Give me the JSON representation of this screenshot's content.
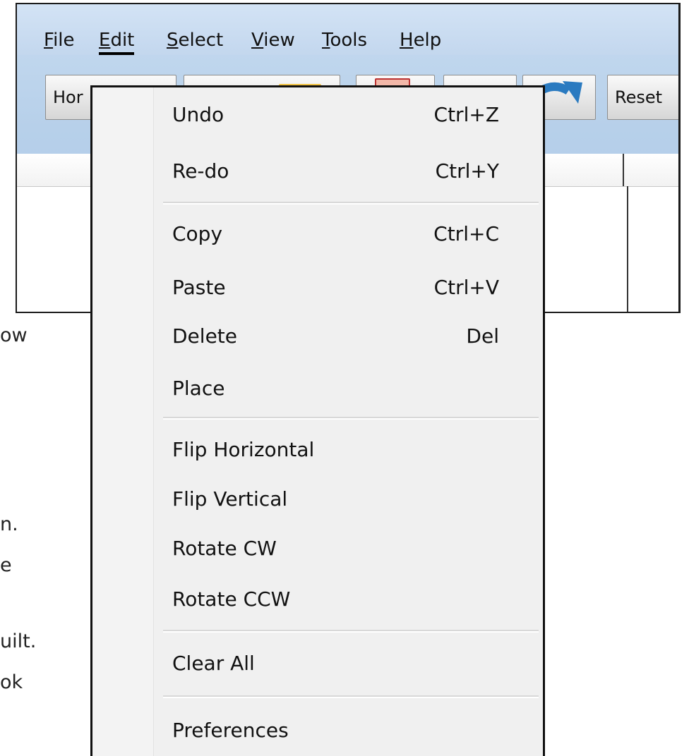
{
  "menubar": {
    "items": [
      {
        "mnemonic": "F",
        "rest": "ile"
      },
      {
        "mnemonic": "E",
        "rest": "dit"
      },
      {
        "mnemonic": "S",
        "rest": "elect"
      },
      {
        "mnemonic": "V",
        "rest": "iew"
      },
      {
        "mnemonic": "T",
        "rest": "ools"
      },
      {
        "mnemonic": "H",
        "rest": "elp"
      }
    ]
  },
  "toolbar": {
    "home_label": "Hor",
    "reset_label": "Reset"
  },
  "background_text": [
    "ow",
    "n.",
    "e",
    "uilt.",
    "ok"
  ],
  "edit_menu": {
    "items": [
      {
        "label": "Undo",
        "shortcut": "Ctrl+Z"
      },
      {
        "label": "Re-do",
        "shortcut": "Ctrl+Y"
      },
      {
        "label": "Copy",
        "shortcut": "Ctrl+C"
      },
      {
        "label": "Paste",
        "shortcut": "Ctrl+V"
      },
      {
        "label": "Delete",
        "shortcut": "Del"
      },
      {
        "label": "Place",
        "shortcut": ""
      },
      {
        "label": "Flip Horizontal",
        "shortcut": ""
      },
      {
        "label": "Flip Vertical",
        "shortcut": ""
      },
      {
        "label": "Rotate CW",
        "shortcut": ""
      },
      {
        "label": "Rotate CCW",
        "shortcut": ""
      },
      {
        "label": "Clear All",
        "shortcut": ""
      },
      {
        "label": "Preferences",
        "shortcut": ""
      }
    ]
  },
  "colors": {
    "window_chrome": "#c3d7ee",
    "menu_background": "#f0f0f0",
    "redo_icon": "#2a7ac0"
  }
}
